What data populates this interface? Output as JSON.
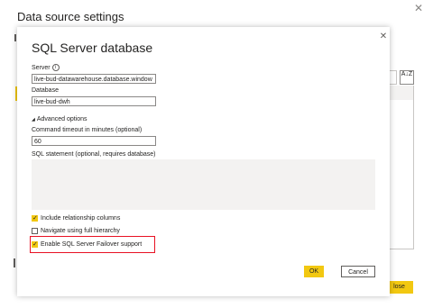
{
  "outer": {
    "title": "Data source settings",
    "close_label": "lose",
    "sort_icon_text": "A↓Z"
  },
  "dialog": {
    "title": "SQL Server database",
    "server_label": "Server",
    "server_value": "live-bud-datawarehouse.database.window",
    "database_label": "Database",
    "database_value": "live-bud-dwh",
    "advanced_label": "Advanced options",
    "timeout_label": "Command timeout in minutes (optional)",
    "timeout_value": "60",
    "sql_label": "SQL statement (optional, requires database)",
    "sql_value": "",
    "checkboxes": [
      {
        "label": "Include relationship columns",
        "checked": true
      },
      {
        "label": "Navigate using full hierarchy",
        "checked": false
      },
      {
        "label": "Enable SQL Server Failover support",
        "checked": true
      }
    ],
    "ok_label": "OK",
    "cancel_label": "Cancel"
  },
  "colors": {
    "accent": "#f2c811",
    "highlight": "#e81123"
  }
}
